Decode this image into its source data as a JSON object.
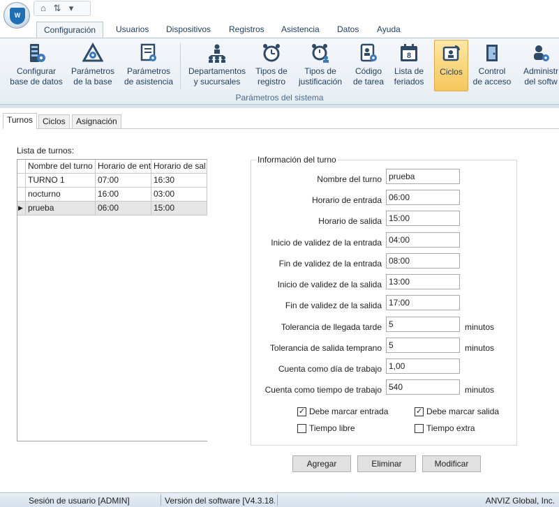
{
  "ribbon_tabs": [
    "Configuración",
    "Usuarios",
    "Dispositivos",
    "Registros",
    "Asistencia",
    "Datos",
    "Ayuda"
  ],
  "ribbon_buttons": [
    {
      "line1": "Configurar",
      "line2": "base de datos",
      "icon": "server-gear-icon"
    },
    {
      "line1": "Parámetros",
      "line2": "de la base",
      "icon": "triangle-gear-icon"
    },
    {
      "line1": "Parámetros",
      "line2": "de asistencia",
      "icon": "document-gear-icon"
    },
    {
      "line1": "Departamentos",
      "line2": "y sucursales",
      "icon": "org-chart-icon"
    },
    {
      "line1": "Tipos de",
      "line2": "registro",
      "icon": "alarm-clock-icon"
    },
    {
      "line1": "Tipos de",
      "line2": "justificación",
      "icon": "alarm-clock-person-icon"
    },
    {
      "line1": "Código",
      "line2": "de tarea",
      "icon": "id-card-gear-icon"
    },
    {
      "line1": "Lista de",
      "line2": "feriados",
      "icon": "calendar-icon"
    },
    {
      "line1": "Ciclos",
      "line2": "",
      "icon": "cycle-person-icon"
    },
    {
      "line1": "Control",
      "line2": "de acceso",
      "icon": "door-icon"
    },
    {
      "line1": "Administr",
      "line2": "del softw",
      "icon": "admin-gear-icon"
    }
  ],
  "ribbon_group_label": "Parámetros del sistema",
  "page_tabs": [
    "Turnos",
    "Ciclos",
    "Asignación"
  ],
  "shift_list": {
    "label": "Lista de turnos:",
    "columns": [
      "Nombre del turno",
      "Horario de entr",
      "Horario de sal"
    ],
    "rows": [
      [
        "TURNO 1",
        "07:00",
        "16:30"
      ],
      [
        "nocturno",
        "16:00",
        "03:00"
      ],
      [
        "prueba",
        "06:00",
        "15:00"
      ]
    ],
    "selected_row": 2
  },
  "shift_info": {
    "title": "Información del turno",
    "fields": [
      {
        "label": "Nombre del turno",
        "value": "prueba",
        "unit": ""
      },
      {
        "label": "Horario de entrada",
        "value": "06:00",
        "unit": ""
      },
      {
        "label": "Horario de salida",
        "value": "15:00",
        "unit": ""
      },
      {
        "label": "Inicio de validez de la entrada",
        "value": "04:00",
        "unit": ""
      },
      {
        "label": "Fin de validez de la entrada",
        "value": "08:00",
        "unit": ""
      },
      {
        "label": "Inicio de validez de la salida",
        "value": "13:00",
        "unit": ""
      },
      {
        "label": "Fin de validez de la salida",
        "value": "17:00",
        "unit": ""
      },
      {
        "label": "Tolerancia de llegada tarde",
        "value": "5",
        "unit": "minutos"
      },
      {
        "label": "Tolerancia de salida temprano",
        "value": "5",
        "unit": "minutos"
      },
      {
        "label": "Cuenta como día de trabajo",
        "value": "1,00",
        "unit": ""
      },
      {
        "label": "Cuenta como tiempo de trabajo",
        "value": "540",
        "unit": "minutos"
      }
    ],
    "checkboxes": [
      {
        "label": "Debe marcar entrada",
        "checked": true
      },
      {
        "label": "Debe marcar salida",
        "checked": true
      },
      {
        "label": "Tiempo libre",
        "checked": false
      },
      {
        "label": "Tiempo extra",
        "checked": false
      }
    ]
  },
  "buttons": {
    "add": "Agregar",
    "delete": "Eliminar",
    "modify": "Modificar"
  },
  "status": {
    "session": "Sesión de usuario  [ADMIN]",
    "version": "Versión del software  [V4.3.18.(",
    "company": "ANVIZ Global, Inc."
  }
}
